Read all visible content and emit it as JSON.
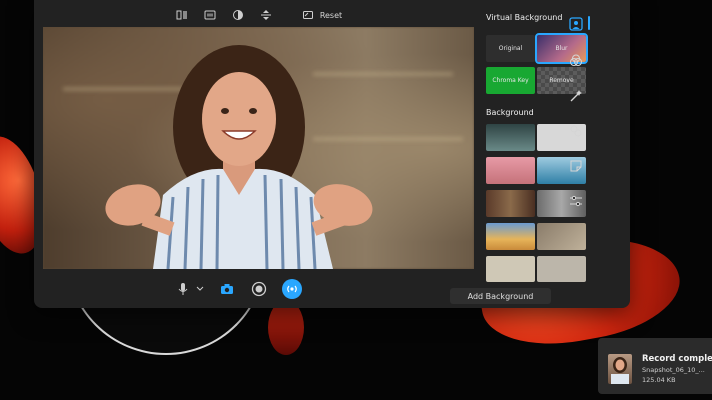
{
  "toolbar": {
    "icons": [
      "mirror-icon",
      "hd-icon",
      "contrast-icon",
      "flip-vertical-icon",
      "crop-icon"
    ],
    "reset_label": "Reset"
  },
  "panel": {
    "virtual_background_title": "Virtual Background",
    "virtual_tiles": [
      {
        "label": "Original",
        "color": "#2e2e2e",
        "selected": false
      },
      {
        "label": "Blur",
        "color": "#7a5a8a",
        "selected": true
      },
      {
        "label": "Chroma Key",
        "color": "#18a832",
        "selected": false
      },
      {
        "label": "Remove",
        "color": "#555555",
        "selected": false
      }
    ],
    "background_title": "Background",
    "background_tiles": [
      {
        "name": "modern-interior",
        "color": "#4f6a6a"
      },
      {
        "name": "white-texture",
        "color": "#d8d8d8"
      },
      {
        "name": "eiffel-tower",
        "color": "#d98a96"
      },
      {
        "name": "pool-resort",
        "color": "#5aa6c9"
      },
      {
        "name": "bookshelf-room",
        "color": "#6a4a3a"
      },
      {
        "name": "gray-arches",
        "color": "#8c8c8c"
      },
      {
        "name": "desert-sunset",
        "color": "#d89a4a"
      },
      {
        "name": "stone-texture",
        "color": "#a89a86"
      },
      {
        "name": "pale-room",
        "color": "#cfc8b6"
      },
      {
        "name": "paper-texture",
        "color": "#bcb6aa"
      }
    ],
    "add_background_label": "Add Background"
  },
  "side_rail": {
    "icons": [
      "portrait-icon",
      "effects-icon",
      "magic-wand-icon",
      "filter-icon",
      "sticker-icon",
      "sliders-icon"
    ]
  },
  "controls": {
    "icons": [
      "microphone-icon",
      "camera-icon",
      "record-icon",
      "live-broadcast-icon"
    ]
  },
  "toast": {
    "title": "Record complete",
    "filename": "Snapshot_06_10_...",
    "size": "125.04 KB"
  },
  "colors": {
    "accent": "#2aa7ff",
    "window": "#222222",
    "chroma_green": "#18a832"
  }
}
